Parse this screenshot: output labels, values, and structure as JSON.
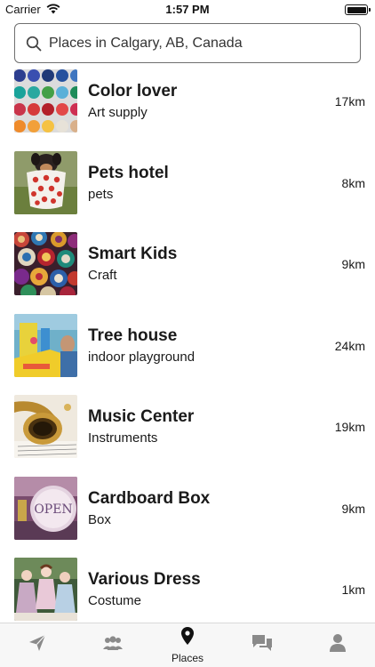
{
  "status_bar": {
    "carrier": "Carrier",
    "time": "1:57 PM"
  },
  "search": {
    "placeholder": "Places in Calgary, AB, Canada"
  },
  "places": [
    {
      "name": "Color lover",
      "category": "Art supply",
      "distance": "17km",
      "image": "paint-palette"
    },
    {
      "name": "Pets hotel",
      "category": "pets",
      "distance": "8km",
      "image": "puppy-in-cup"
    },
    {
      "name": "Smart Kids",
      "category": "Craft",
      "distance": "9km",
      "image": "colorful-plates"
    },
    {
      "name": "Tree house",
      "category": "indoor playground",
      "distance": "24km",
      "image": "playground"
    },
    {
      "name": "Music Center",
      "category": "Instruments",
      "distance": "19km",
      "image": "saxophone"
    },
    {
      "name": "Cardboard Box",
      "category": "Box",
      "distance": "9km",
      "image": "open-sign"
    },
    {
      "name": "Various Dress",
      "category": "Costume",
      "distance": "1km",
      "image": "dolls"
    }
  ],
  "tab_bar": {
    "tabs": [
      {
        "icon": "send-icon",
        "label": ""
      },
      {
        "icon": "group-icon",
        "label": ""
      },
      {
        "icon": "map-pin-icon",
        "label": "Places"
      },
      {
        "icon": "chat-icon",
        "label": ""
      },
      {
        "icon": "profile-icon",
        "label": ""
      }
    ]
  }
}
